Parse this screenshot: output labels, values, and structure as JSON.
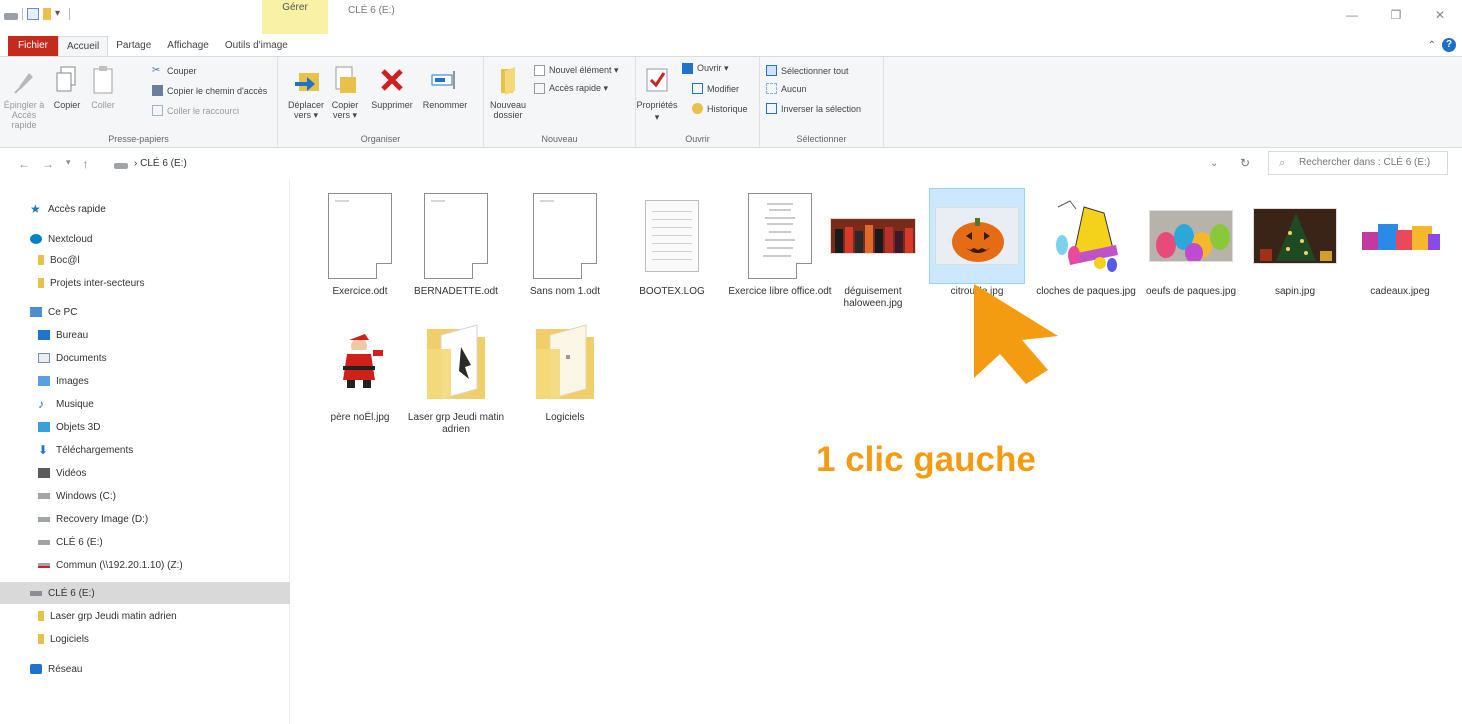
{
  "window": {
    "context_group": "Gérer",
    "title": "CLÉ 6 (E:)",
    "controls": [
      "—",
      "❐",
      "✕"
    ]
  },
  "tabs": {
    "file": "Fichier",
    "home": "Accueil",
    "share": "Partage",
    "view": "Affichage",
    "image_tools": "Outils d'image"
  },
  "ribbon": {
    "clipboard": {
      "label": "Presse-papiers",
      "pin": "Épingler à Accès rapide",
      "copy": "Copier",
      "paste": "Coller",
      "cut": "Couper",
      "copy_path": "Copier le chemin d'accès",
      "paste_shortcut": "Coller le raccourci"
    },
    "organize": {
      "label": "Organiser",
      "move_to": "Déplacer vers ▾",
      "copy_to": "Copier vers ▾",
      "delete": "Supprimer",
      "rename": "Renommer"
    },
    "new": {
      "label": "Nouveau",
      "new_folder": "Nouveau dossier",
      "new_item": "Nouvel élément ▾",
      "easy_access": "Accès rapide ▾"
    },
    "open": {
      "label": "Ouvrir",
      "properties": "Propriétés",
      "open": "Ouvrir ▾",
      "edit": "Modifier",
      "history": "Historique"
    },
    "select": {
      "label": "Sélectionner",
      "select_all": "Sélectionner tout",
      "select_none": "Aucun",
      "invert": "Inverser la sélection"
    }
  },
  "address": {
    "path": "CLÉ 6 (E:)",
    "search_placeholder": "Rechercher dans : CLÉ 6 (E:)"
  },
  "sidebar": {
    "items": [
      {
        "label": "Accès rapide",
        "icon": "star-icon"
      },
      {
        "label": "Nextcloud",
        "icon": "nextcloud-icon"
      },
      {
        "label": "Boc@l",
        "icon": "folder-icon"
      },
      {
        "label": "Projets inter-secteurs",
        "icon": "folder-icon"
      },
      {
        "label": "Ce PC",
        "icon": "pc-icon"
      },
      {
        "label": "Bureau",
        "icon": "desktop-icon"
      },
      {
        "label": "Documents",
        "icon": "documents-icon"
      },
      {
        "label": "Images",
        "icon": "images-icon"
      },
      {
        "label": "Musique",
        "icon": "music-icon"
      },
      {
        "label": "Objets 3D",
        "icon": "objects3d-icon"
      },
      {
        "label": "Téléchargements",
        "icon": "download-icon"
      },
      {
        "label": "Vidéos",
        "icon": "video-icon"
      },
      {
        "label": "Windows (C:)",
        "icon": "windows-drive-icon"
      },
      {
        "label": "Recovery Image (D:)",
        "icon": "drive-icon"
      },
      {
        "label": "CLÉ 6 (E:)",
        "icon": "usb-drive-icon"
      },
      {
        "label": "Commun (\\\\192.20.1.10) (Z:)",
        "icon": "network-drive-icon"
      },
      {
        "label": "CLÉ 6 (E:)",
        "icon": "usb-drive-icon"
      },
      {
        "label": "Laser grp Jeudi matin adrien",
        "icon": "folder-icon"
      },
      {
        "label": "Logiciels",
        "icon": "folder-icon"
      },
      {
        "label": "Réseau",
        "icon": "network-icon"
      }
    ]
  },
  "files": [
    {
      "name": "Exercice.odt",
      "kind": "odt"
    },
    {
      "name": "BERNADETTE.odt",
      "kind": "odt"
    },
    {
      "name": "Sans nom 1.odt",
      "kind": "odt"
    },
    {
      "name": "BOOTEX.LOG",
      "kind": "log"
    },
    {
      "name": "Exercice libre office.odt",
      "kind": "odt"
    },
    {
      "name": "déguisement haloween.jpg",
      "kind": "jpg"
    },
    {
      "name": "citrouille.jpg",
      "kind": "jpg",
      "selected": true
    },
    {
      "name": "cloches de paques.jpg",
      "kind": "jpg"
    },
    {
      "name": "oeufs de paques.jpg",
      "kind": "jpg"
    },
    {
      "name": "sapin.jpg",
      "kind": "jpg"
    },
    {
      "name": "cadeaux.jpeg",
      "kind": "jpg"
    },
    {
      "name": "père noËl.jpg",
      "kind": "jpg"
    },
    {
      "name": "Laser grp Jeudi matin adrien",
      "kind": "folder"
    },
    {
      "name": "Logiciels",
      "kind": "folder"
    }
  ],
  "annotation": {
    "text": "1 clic gauche",
    "color": "#f39c12"
  },
  "colors": {
    "file_tab": "#c42b1c",
    "selection": "#cce8ff",
    "context_tab": "#f9f1a5"
  }
}
